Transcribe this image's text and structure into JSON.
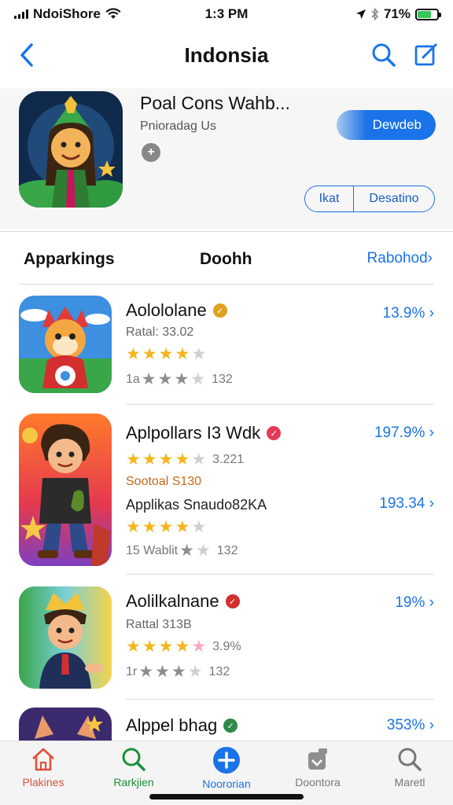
{
  "status_bar": {
    "carrier": "NdoiShore",
    "time": "1:3 PM",
    "battery": "71%"
  },
  "nav": {
    "title": "Indonsia"
  },
  "hero": {
    "app_name": "Poal Cons  Wahb...",
    "subtitle": "Pnioradag Us",
    "plus_symbol": "+",
    "get_label": "Dewdeb",
    "seg_first": "Ikat",
    "seg_second": "Desatino"
  },
  "section": {
    "title": "Apparkings",
    "middle": "Doohh",
    "link": "Rabohod",
    "link_chevron": "›"
  },
  "apps": [
    {
      "title": "Aolololane",
      "meta": "Ratal: 33.02",
      "footer": "1a",
      "footer_count": "132",
      "percent": "13.9%",
      "chevron": "›"
    },
    {
      "title": "Aplpollars I3 Wdk",
      "rating_count": "3.221",
      "meta": "Sootoal S130",
      "subtitle": "Applikas Snaudo82KA",
      "footer": "15 Wablit",
      "footer_count": "132",
      "percent": "197.9%",
      "percent_2": "193.34",
      "chevron": "›"
    },
    {
      "title": "Aolilkalnane",
      "meta": "Rattal 313B",
      "rating_count": "3.9%",
      "footer": "1r",
      "footer_count": "132",
      "percent": "19%",
      "chevron": "›"
    },
    {
      "title": "Alppel bhag",
      "percent": "353%",
      "chevron": "›"
    }
  ],
  "tabs": [
    {
      "label": "Plakines",
      "color": "#e0513a"
    },
    {
      "label": "Rarkjien",
      "color": "#1e8f3a"
    },
    {
      "label": "Noororian",
      "color": "#1a73e8"
    },
    {
      "label": "Doontora",
      "color": "#777777"
    },
    {
      "label": "Maretl",
      "color": "#777777"
    }
  ],
  "colors": {
    "accent": "#1a73e8",
    "star": "#f5b51c"
  }
}
